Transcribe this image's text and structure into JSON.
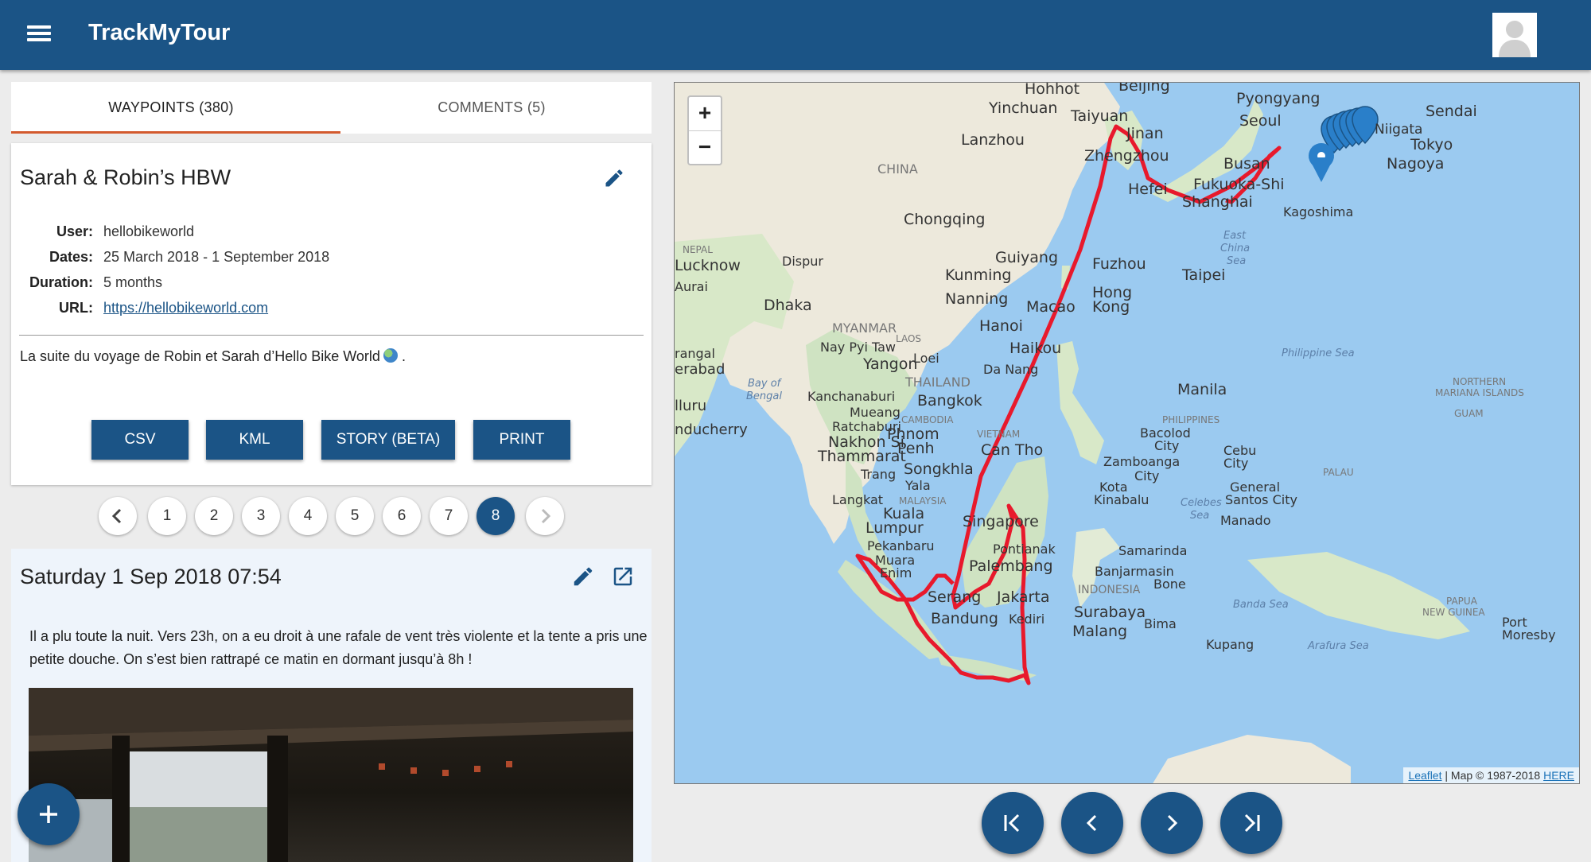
{
  "header": {
    "title": "TrackMyTour"
  },
  "tabs": [
    {
      "label": "WAYPOINTS (380)"
    },
    {
      "label": "COMMENTS (5)"
    }
  ],
  "tour": {
    "title": "Sarah & Robin’s HBW",
    "meta": [
      {
        "key": "User:",
        "value": "hellobikeworld"
      },
      {
        "key": "Dates:",
        "value": "25 March 2018 - 1 September 2018"
      },
      {
        "key": "Duration:",
        "value": "5 months"
      },
      {
        "key": "URL:",
        "value": "https://hellobikeworld.com"
      }
    ],
    "description": "La suite du voyage de Robin et Sarah d’Hello Bike World",
    "buttons": [
      "CSV",
      "KML",
      "STORY (BETA)",
      "PRINT"
    ]
  },
  "pagination": {
    "pages": [
      "1",
      "2",
      "3",
      "4",
      "5",
      "6",
      "7",
      "8"
    ],
    "current": "8"
  },
  "waypoint": {
    "date": "Saturday 1 Sep 2018 07:54",
    "text": "Il a plu toute la nuit. Vers 23h, on a eu droit à une rafale de vent très violente et la tente a pris une petite douche. On s’est bien rattrapé ce matin en dormant jusqu’à 8h !"
  },
  "map": {
    "zoom_in": "+",
    "zoom_out": "−",
    "attribution_leaflet": "Leaflet",
    "attribution_rest": " | Map © 1987-2018 ",
    "attribution_here": "HERE",
    "route_color": "#e8192c",
    "marker_color": "#2a7fc9",
    "labels": [
      {
        "text": "Hohhot"
      },
      {
        "text": "Beijing"
      },
      {
        "text": "Yinchuan"
      },
      {
        "text": "Taiyuan"
      },
      {
        "text": "Pyongyang"
      },
      {
        "text": "Seoul"
      },
      {
        "text": "Sendai"
      },
      {
        "text": "Niigata"
      },
      {
        "text": "Tokyo"
      },
      {
        "text": "Nagoya"
      },
      {
        "text": "Lanzhou"
      },
      {
        "text": "Jinan"
      },
      {
        "text": "Zhengzhou"
      },
      {
        "text": "CHINA"
      },
      {
        "text": "Busan"
      },
      {
        "text": "Fukuoka-Shi"
      },
      {
        "text": "Hefei"
      },
      {
        "text": "Shanghai"
      },
      {
        "text": "Kagoshima"
      },
      {
        "text": "Chongqing"
      },
      {
        "text": "East"
      },
      {
        "text": "China"
      },
      {
        "text": "Sea"
      },
      {
        "text": "NEPAL"
      },
      {
        "text": "Guiyang"
      },
      {
        "text": "Fuzhou"
      },
      {
        "text": "Lucknow"
      },
      {
        "text": "Dispur"
      },
      {
        "text": "Kunming"
      },
      {
        "text": "Taipei"
      },
      {
        "text": "Aurai"
      },
      {
        "text": "Nanning"
      },
      {
        "text": "Hong"
      },
      {
        "text": "Kong"
      },
      {
        "text": "Macao"
      },
      {
        "text": "Dhaka"
      },
      {
        "text": "MYANMAR"
      },
      {
        "text": "Hanoi"
      },
      {
        "text": "Haikou"
      },
      {
        "text": "Nay Pyi Taw"
      },
      {
        "text": "LAOS"
      },
      {
        "text": "Philippine Sea"
      },
      {
        "text": "rangal"
      },
      {
        "text": "erabad"
      },
      {
        "text": "Yangon"
      },
      {
        "text": "Loei"
      },
      {
        "text": "Da Nang"
      },
      {
        "text": "THAILAND"
      },
      {
        "text": "Bay of"
      },
      {
        "text": "Bengal"
      },
      {
        "text": "Manila"
      },
      {
        "text": "NORTHERN"
      },
      {
        "text": "MARIANA ISLANDS"
      },
      {
        "text": "Kanchanaburi"
      },
      {
        "text": "Bangkok"
      },
      {
        "text": "Mueang"
      },
      {
        "text": "Ratchaburi"
      },
      {
        "text": "CAMBODIA"
      },
      {
        "text": "PHILIPPINES"
      },
      {
        "text": "GUAM"
      },
      {
        "text": "lluru"
      },
      {
        "text": "Bacolod"
      },
      {
        "text": "City"
      },
      {
        "text": "nducherry"
      },
      {
        "text": "Phnom"
      },
      {
        "text": "Penh"
      },
      {
        "text": "VIETNAM"
      },
      {
        "text": "Nakhon Si"
      },
      {
        "text": "Thammarat"
      },
      {
        "text": "Can Tho"
      },
      {
        "text": "Cebu"
      },
      {
        "text": "City"
      },
      {
        "text": "Zamboanga"
      },
      {
        "text": "City"
      },
      {
        "text": "Songkhla"
      },
      {
        "text": "PALAU"
      },
      {
        "text": "Trang"
      },
      {
        "text": "Yala"
      },
      {
        "text": "General"
      },
      {
        "text": "Santos City"
      },
      {
        "text": "Langkat"
      },
      {
        "text": "MALAYSIA"
      },
      {
        "text": "Kota"
      },
      {
        "text": "Kinabalu"
      },
      {
        "text": "Celebes"
      },
      {
        "text": "Sea"
      },
      {
        "text": "Kuala"
      },
      {
        "text": "Lumpur"
      },
      {
        "text": "Singapore"
      },
      {
        "text": "Manado"
      },
      {
        "text": "Pekanbaru"
      },
      {
        "text": "Pontianak"
      },
      {
        "text": "Samarinda"
      },
      {
        "text": "Muara"
      },
      {
        "text": "Enim"
      },
      {
        "text": "Palembang"
      },
      {
        "text": "Banjarmasin"
      },
      {
        "text": "INDONESIA"
      },
      {
        "text": "Bone"
      },
      {
        "text": "Serang"
      },
      {
        "text": "Jakarta"
      },
      {
        "text": "Banda Sea"
      },
      {
        "text": "PAPUA"
      },
      {
        "text": "NEW GUINEA"
      },
      {
        "text": "Surabaya"
      },
      {
        "text": "Bandung"
      },
      {
        "text": "Kediri"
      },
      {
        "text": "Bima"
      },
      {
        "text": "Port"
      },
      {
        "text": "Moresby"
      },
      {
        "text": "Malang"
      },
      {
        "text": "Kupang"
      },
      {
        "text": "Arafura Sea"
      }
    ]
  },
  "map_nav": [
    "first-waypoint",
    "previous-waypoint",
    "next-waypoint",
    "last-waypoint"
  ]
}
